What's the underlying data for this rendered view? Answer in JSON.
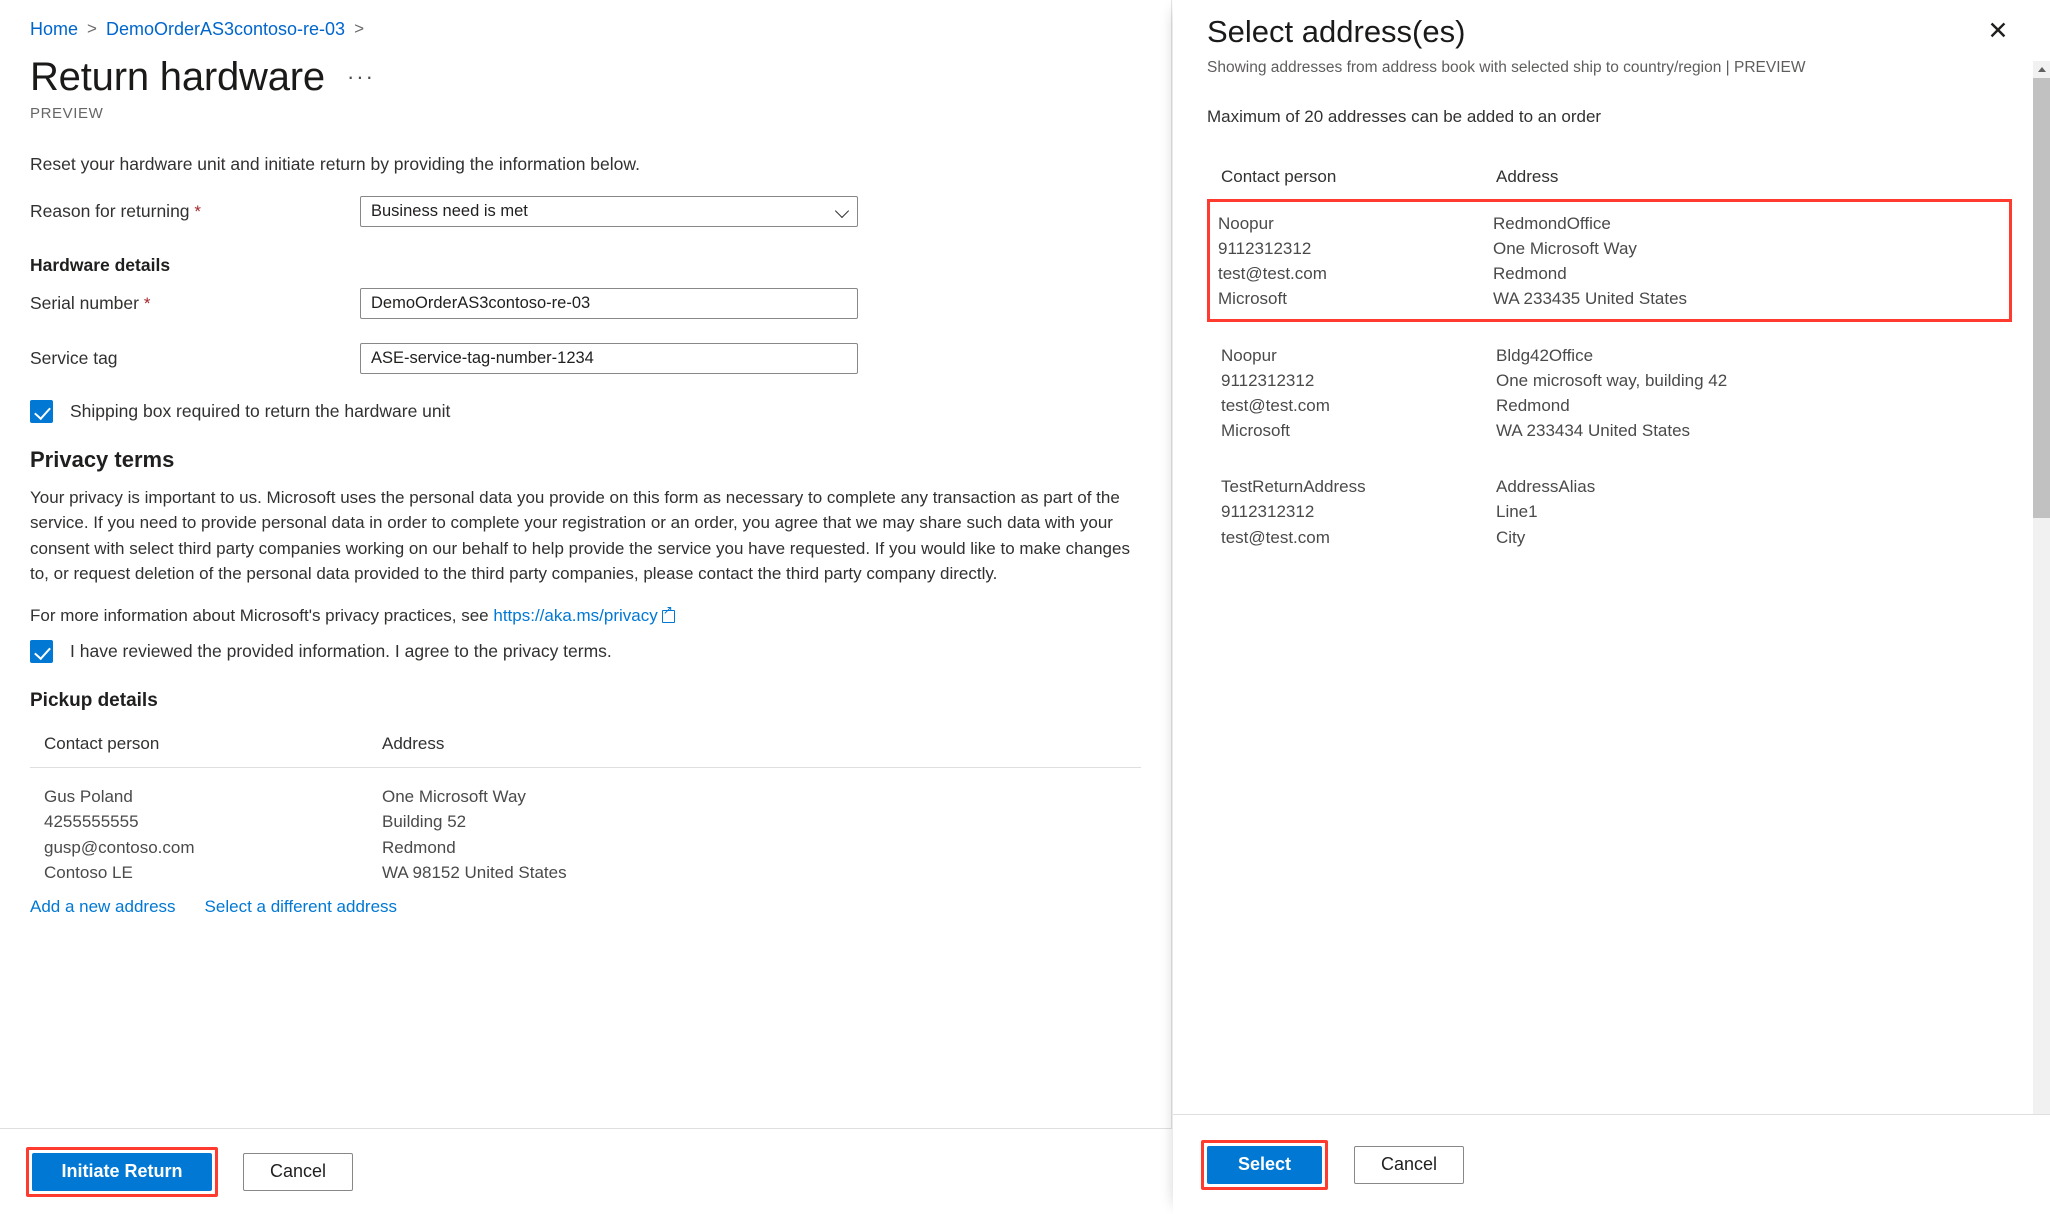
{
  "left": {
    "breadcrumb": {
      "home": "Home",
      "order": "DemoOrderAS3contoso-re-03"
    },
    "title": "Return hardware",
    "ellipsis": "···",
    "preview": "PREVIEW",
    "intro": "Reset your hardware unit and initiate return by providing the information below.",
    "reason": {
      "label": "Reason for returning",
      "required": "*",
      "value": "Business need is met"
    },
    "hardware_details_head": "Hardware details",
    "serial": {
      "label": "Serial number",
      "required": "*",
      "value": "DemoOrderAS3contoso-re-03"
    },
    "service_tag": {
      "label": "Service tag",
      "value": "ASE-service-tag-number-1234"
    },
    "shipping_box_checkbox": "Shipping box required to return the hardware unit",
    "privacy_head": "Privacy terms",
    "privacy_body": "Your privacy is important to us. Microsoft uses the personal data you provide on this form as necessary to complete any transaction as part of the service. If you need to provide personal data in order to complete your registration or an order, you agree that we may share such data with your consent with select third party companies working on our behalf to help provide the service you have requested. If you would like to make changes to, or request deletion of the personal data provided to the third party companies, please contact the third party company directly.",
    "privacy_more_prefix": "For more information about Microsoft's privacy practices, see ",
    "privacy_link": "https://aka.ms/privacy",
    "privacy_agree_checkbox": "I have reviewed the provided information. I agree to the privacy terms.",
    "pickup_head": "Pickup details",
    "table": {
      "headers": {
        "contact": "Contact person",
        "address": "Address"
      },
      "row": {
        "contact": [
          "Gus Poland",
          "4255555555",
          "gusp@contoso.com",
          "Contoso LE"
        ],
        "address": [
          "One Microsoft Way",
          "Building 52",
          "Redmond",
          "WA 98152 United States"
        ]
      }
    },
    "links": {
      "add_new": "Add a new address",
      "select_different": "Select a different address"
    },
    "footer": {
      "primary": "Initiate Return",
      "cancel": "Cancel"
    }
  },
  "right": {
    "title": "Select address(es)",
    "subtitle": "Showing addresses from address book with selected ship to country/region | PREVIEW",
    "note": "Maximum of 20 addresses can be added to an order",
    "close_icon": "✕",
    "headers": {
      "contact": "Contact person",
      "address": "Address"
    },
    "addresses": [
      {
        "highlighted": true,
        "contact": [
          "Noopur",
          "9112312312",
          "test@test.com",
          "Microsoft"
        ],
        "address": [
          "RedmondOffice",
          "One Microsoft Way",
          "Redmond",
          "WA 233435 United States"
        ]
      },
      {
        "highlighted": false,
        "contact": [
          "Noopur",
          "9112312312",
          "test@test.com",
          "Microsoft"
        ],
        "address": [
          "Bldg42Office",
          "One microsoft way, building 42",
          "Redmond",
          "WA 233434 United States"
        ]
      },
      {
        "highlighted": false,
        "contact": [
          "TestReturnAddress",
          "9112312312",
          "test@test.com"
        ],
        "address": [
          "AddressAlias",
          "Line1",
          "City"
        ]
      }
    ],
    "footer": {
      "primary": "Select",
      "cancel": "Cancel"
    }
  },
  "colors": {
    "accent": "#0078d4",
    "link": "#0066cc",
    "highlight": "#ff3b30",
    "required": "#a4262c"
  }
}
